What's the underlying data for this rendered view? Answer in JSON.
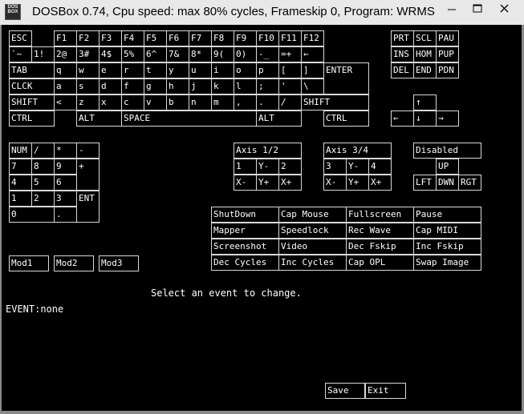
{
  "window": {
    "icon_text_line1": "DOS",
    "icon_text_line2": "BOX",
    "title": "DOSBox 0.74, Cpu speed: max  80% cycles, Frameskip  0, Program:    WRMS",
    "minimize_glyph": "—",
    "maximize_glyph": "☐",
    "close_glyph": "✕"
  },
  "keys": {
    "esc": "ESC",
    "f1": "F1",
    "f2": "F2",
    "f3": "F3",
    "f4": "F4",
    "f5": "F5",
    "f6": "F6",
    "f7": "F7",
    "f8": "F8",
    "f9": "F9",
    "f10": "F10",
    "f11": "F11",
    "f12": "F12",
    "prt": "PRT",
    "scl": "SCL",
    "pau": "PAU",
    "grave": "`~",
    "n1": "1!",
    "n2": "2@",
    "n3": "3#",
    "n4": "4$",
    "n5": "5%",
    "n6": "6^",
    "n7": "7&",
    "n8": "8*",
    "n9": "9(",
    "n0": "0)",
    "minus": "-_",
    "equals": "=+",
    "backspace": "←",
    "ins": "INS",
    "hom": "HOM",
    "pup": "PUP",
    "tab": "TAB",
    "q": "q",
    "w": "w",
    "e": "e",
    "r": "r",
    "t": "t",
    "y": "y",
    "u": "u",
    "i": "i",
    "o": "o",
    "p": "p",
    "lbracket": "[",
    "rbracket": "]",
    "enter": "ENTER",
    "del": "DEL",
    "end": "END",
    "pdn": "PDN",
    "clck": "CLCK",
    "a": "a",
    "s": "s",
    "d": "d",
    "f": "f",
    "g": "g",
    "h": "h",
    "j": "j",
    "k": "k",
    "l": "l",
    "semicolon": ";",
    "quote": "'",
    "backslash": "\\",
    "lshift": "SHIFT",
    "lt": "<",
    "z": "z",
    "x": "x",
    "c": "c",
    "v": "v",
    "b": "b",
    "n": "n",
    "m": "m",
    "comma": ",",
    "period": ".",
    "slash": "/",
    "rshift": "SHIFT",
    "up": "↑",
    "lctrl": "CTRL",
    "lalt": "ALT",
    "space": "SPACE",
    "ralt": "ALT",
    "rctrl": "CTRL",
    "left": "←",
    "down": "↓",
    "right": "→"
  },
  "numpad": {
    "num": "NUM",
    "div": "/",
    "mul": "*",
    "sub": "-",
    "k7": "7",
    "k8": "8",
    "k9": "9",
    "add": "+",
    "k4": "4",
    "k5": "5",
    "k6": "6",
    "k1": "1",
    "k2": "2",
    "k3": "3",
    "ent": "ENT",
    "k0": "0",
    "dot": "."
  },
  "joystick": {
    "axis12": "Axis 1/2",
    "axis34": "Axis 3/4",
    "a1_btn1": "1",
    "a1_yminus": "Y-",
    "a1_btn2": "2",
    "a1_xminus": "X-",
    "a1_yplus": "Y+",
    "a1_xplus": "X+",
    "a2_btn3": "3",
    "a2_yminus": "Y-",
    "a2_btn4": "4",
    "a2_xminus": "X-",
    "a2_yplus": "Y+",
    "a2_xplus": "X+",
    "hat_disabled": "Disabled",
    "hat_up": "UP",
    "hat_left": "LFT",
    "hat_down": "DWN",
    "hat_right": "RGT"
  },
  "events": {
    "shutdown": "ShutDown",
    "capmouse": "Cap Mouse",
    "fullscreen": "Fullscreen",
    "pause": "Pause",
    "mapper": "Mapper",
    "speedlock": "Speedlock",
    "recwave": "Rec Wave",
    "capmidi": "Cap MIDI",
    "screenshot": "Screenshot",
    "video": "Video",
    "decfskip": "Dec Fskip",
    "incfskip": "Inc Fskip",
    "deccycles": "Dec Cycles",
    "inccycles": "Inc Cycles",
    "capopl": "Cap OPL",
    "swapimage": "Swap Image"
  },
  "mods": {
    "mod1": "Mod1",
    "mod2": "Mod2",
    "mod3": "Mod3"
  },
  "status": {
    "prompt": "Select an event to change.",
    "event_line": "EVENT:none"
  },
  "actions": {
    "save": "Save",
    "exit": "Exit"
  }
}
